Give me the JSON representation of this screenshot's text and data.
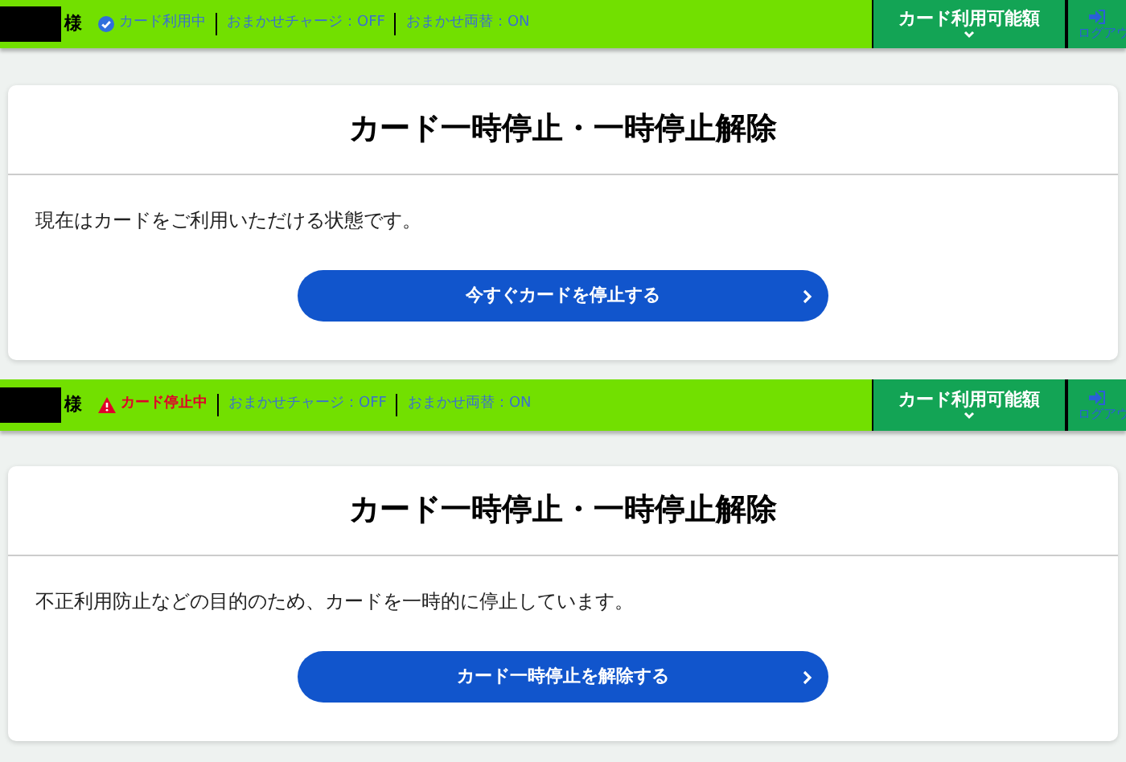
{
  "panels": [
    {
      "header": {
        "honorific": "様",
        "card_status": {
          "kind": "active",
          "label": "カード利用中"
        },
        "auto_charge": "おまかせチャージ：OFF",
        "auto_exchange": "おまかせ両替：ON",
        "menu_label": "カード利用可能額",
        "logout_label": "ログアウ"
      },
      "card": {
        "title": "カード一時停止・一時停止解除",
        "message": "現在はカードをご利用いただける状態です。",
        "button": "今すぐカードを停止する"
      }
    },
    {
      "header": {
        "honorific": "様",
        "card_status": {
          "kind": "suspended",
          "label": "カード停止中"
        },
        "auto_charge": "おまかせチャージ：OFF",
        "auto_exchange": "おまかせ両替：ON",
        "menu_label": "カード利用可能額",
        "logout_label": "ログアウ"
      },
      "card": {
        "title": "カード一時停止・一時停止解除",
        "message": "不正利用防止などの目的のため、カードを一時的に停止しています。",
        "button": "カード一時停止を解除する"
      }
    }
  ]
}
